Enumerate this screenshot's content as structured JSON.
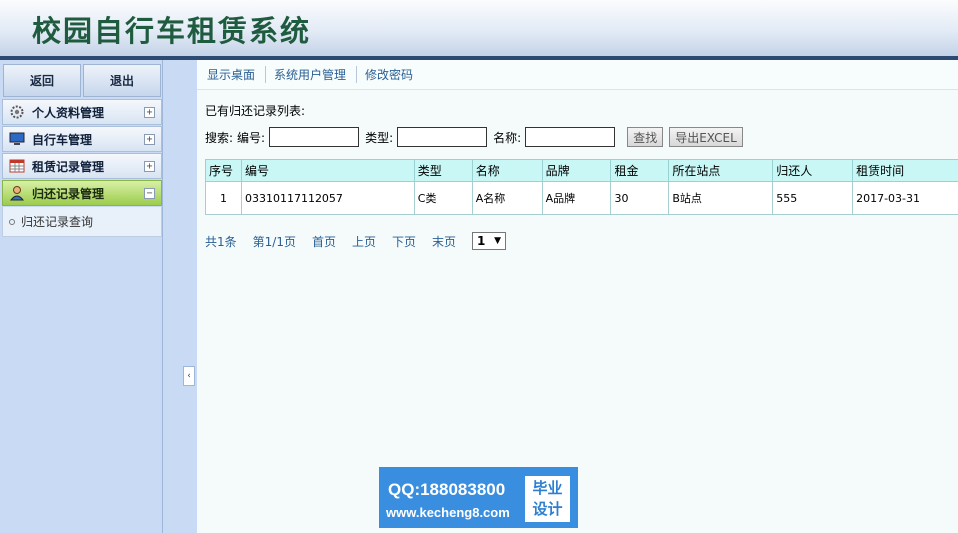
{
  "app": {
    "title": "校园自行车租赁系统"
  },
  "sidebar": {
    "top_buttons": {
      "back": "返回",
      "logout": "退出"
    },
    "menus": [
      {
        "label": "个人资料管理",
        "icon": "gear-icon",
        "toggle": "+"
      },
      {
        "label": "自行车管理",
        "icon": "monitor-icon",
        "toggle": "+"
      },
      {
        "label": "租赁记录管理",
        "icon": "table-icon",
        "toggle": "+"
      },
      {
        "label": "归还记录管理",
        "icon": "user-icon",
        "toggle": "−"
      }
    ],
    "submenu": {
      "label": "归还记录查询"
    },
    "collapse_glyph": "‹"
  },
  "main": {
    "tabs": [
      "显示桌面",
      "系统用户管理",
      "修改密码"
    ],
    "caption": "已有归还记录列表:",
    "search": {
      "prefix": "搜索:",
      "field1_label": "编号:",
      "field2_label": "类型:",
      "field3_label": "名称:",
      "field1_value": "",
      "field2_value": "",
      "field3_value": "",
      "search_button": "查找",
      "export_button": "导出EXCEL"
    },
    "table": {
      "headers": [
        "序号",
        "编号",
        "类型",
        "名称",
        "品牌",
        "租金",
        "所在站点",
        "归还人",
        "租赁时间"
      ],
      "rows": [
        [
          "1",
          "03310117112057",
          "C类",
          "A名称",
          "A品牌",
          "30",
          "B站点",
          "555",
          "2017-03-31"
        ]
      ]
    },
    "pager": {
      "total": "共1条",
      "page": "第1/1页",
      "first": "首页",
      "prev": "上页",
      "next": "下页",
      "last": "末页",
      "selected": "1"
    }
  },
  "watermark": {
    "qq": "QQ:188083800",
    "url": "www.kecheng8.com",
    "badge_line1": "毕业",
    "badge_line2": "设计"
  }
}
